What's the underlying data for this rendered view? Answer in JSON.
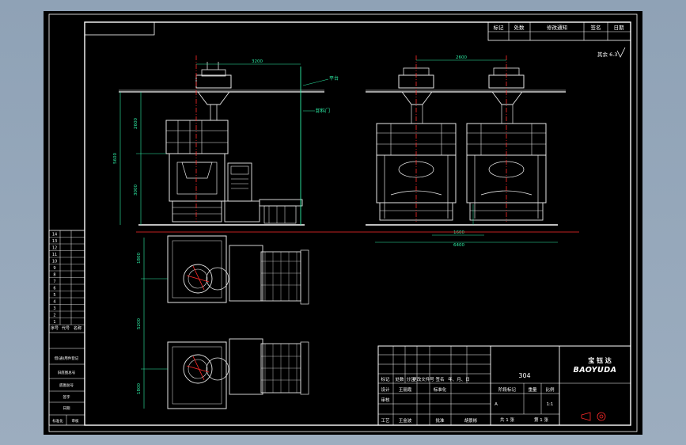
{
  "colors": {
    "background": "#000000",
    "frame": "#ffffff",
    "machine": "#e6e6e6",
    "dimension": "#2ef2a8",
    "center_line": "#ff2a2a",
    "grid": "#5a5a5a",
    "window_bg": "#9fb0c2"
  },
  "revision_table": {
    "headers": [
      "标记",
      "处数",
      "修改通知",
      "签名",
      "日期"
    ]
  },
  "roughness_note": "其余 6.3",
  "annotations": {
    "platform_label": "平台",
    "discharge_label": "卸料门"
  },
  "dimensions": {
    "left_view_width": "3200",
    "right_view_spacing": "2600",
    "left_total_height": "5600",
    "left_upper_height": "2600",
    "left_lower_height": "3000",
    "right_bottom_width": "6400",
    "right_inner_width": "1600",
    "plan_top_depth": "1800",
    "plan_mid_depth": "5200",
    "plan_bottom_depth": "1800"
  },
  "left_sidebar": {
    "rows": [
      "14",
      "13",
      "12",
      "11",
      "10",
      "9",
      "8",
      "7",
      "6",
      "5",
      "4",
      "3",
      "2",
      "1"
    ],
    "header_cells": [
      "序号",
      "代号",
      "名称"
    ],
    "side_labels": [
      "借(通)用件登记",
      "旧底图总号",
      "底图总号",
      "签字",
      "日期"
    ],
    "bottom_labels": [
      "标准化",
      "审核"
    ]
  },
  "title_block": {
    "logo_text": "BAOYUDA",
    "logo_cn": "宝  钰  达",
    "material": "304",
    "headers_row": [
      "标记",
      "处数",
      "分区",
      "更改文件号",
      "签名",
      "年、月、日"
    ],
    "people": {
      "designer_role": "设计",
      "designer_name": "王丽霞",
      "standardize_role": "标准化",
      "check_role": "审核",
      "process_role": "工艺",
      "process_name": "王金波",
      "approve_role": "批准",
      "approve_name": "胡景彬"
    },
    "stage_header": "阶段标记",
    "weight_header": "重量",
    "scale_header": "比例",
    "stage_value": "A",
    "scale_value": "1:1",
    "sheets_text": "共  1  张",
    "sheet_no_text": "第  1  张"
  }
}
